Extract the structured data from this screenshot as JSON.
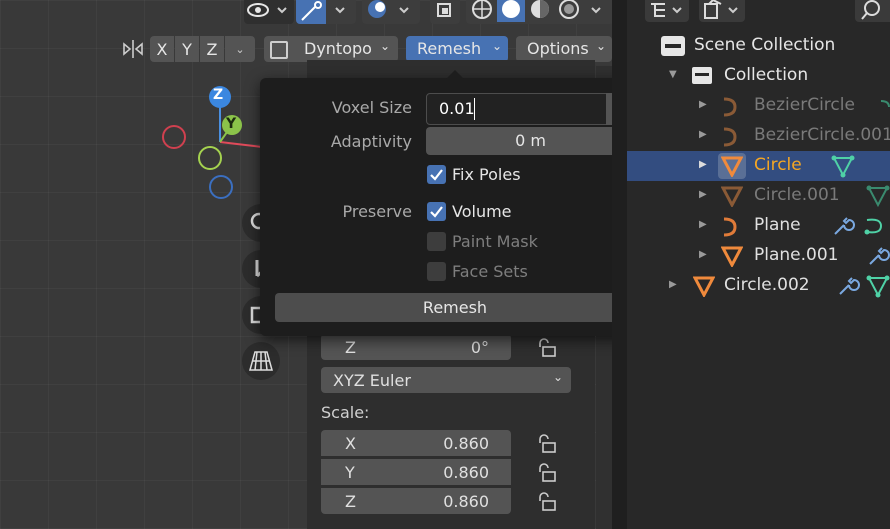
{
  "toolbar": {
    "axes": [
      "X",
      "Y",
      "Z"
    ],
    "dyntopo_label": "Dyntopo",
    "remesh_label": "Remesh",
    "options_label": "Options"
  },
  "gizmo": {
    "z": "Z",
    "y": "Y"
  },
  "popup": {
    "voxel_size_label": "Voxel Size",
    "voxel_size_value": "0.01",
    "adaptivity_label": "Adaptivity",
    "adaptivity_value": "0 m",
    "fix_poles_label": "Fix Poles",
    "fix_poles_checked": true,
    "preserve_label": "Preserve",
    "volume_label": "Volume",
    "volume_checked": true,
    "paint_mask_label": "Paint Mask",
    "paint_mask_checked": false,
    "face_sets_label": "Face Sets",
    "face_sets_checked": false,
    "remesh_button": "Remesh"
  },
  "transform": {
    "rotation_z_label": "Z",
    "rotation_z_value": "0°",
    "rotation_mode": "XYZ Euler",
    "scale_label": "Scale:",
    "scale": [
      {
        "axis": "X",
        "value": "0.860"
      },
      {
        "axis": "Y",
        "value": "0.860"
      },
      {
        "axis": "Z",
        "value": "0.860"
      }
    ]
  },
  "outliner": {
    "scene_collection": "Scene Collection",
    "collection": "Collection",
    "items": [
      {
        "name": "BezierCircle",
        "type": "curve",
        "selected": false,
        "dim": true
      },
      {
        "name": "BezierCircle.001",
        "type": "curve",
        "selected": false,
        "dim": true
      },
      {
        "name": "Circle",
        "type": "mesh",
        "selected": true,
        "dim": false
      },
      {
        "name": "Circle.001",
        "type": "mesh",
        "selected": false,
        "dim": true
      },
      {
        "name": "Plane",
        "type": "curve",
        "selected": false,
        "dim": false
      },
      {
        "name": "Plane.001",
        "type": "mesh",
        "selected": false,
        "dim": false
      },
      {
        "name": "Circle.002",
        "type": "mesh",
        "selected": false,
        "dim": false
      }
    ]
  },
  "colors": {
    "accent_blue": "#4772b3",
    "selected_text": "#f5a623",
    "object_orange": "#e07b39",
    "modifier_blue": "#7aa8e0",
    "mesh_data_green": "#4fd1a6"
  }
}
